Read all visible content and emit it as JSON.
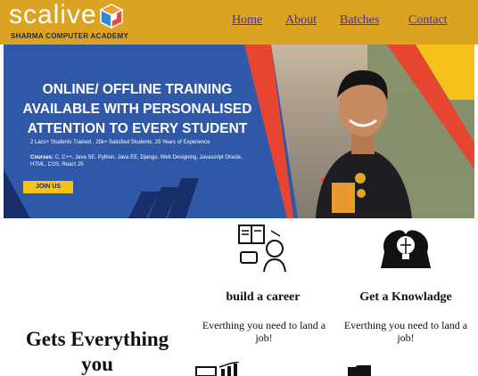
{
  "brand": {
    "name": "scalive",
    "tagline": "SHARMA COMPUTER ACADEMY"
  },
  "nav": {
    "items": [
      "Home",
      "About",
      "Batches",
      "Contact"
    ]
  },
  "hero": {
    "headline": [
      "ONLINE/ OFFLINE TRAINING",
      "AVAILABLE WITH PERSONALISED",
      "ATTENTION TO EVERY STUDENT"
    ],
    "stats": "2 Lacs+ Students Trained , 25k+ Satisfied Students, 25 Years of Experience",
    "courses_label": "Courses:",
    "courses": "C, C++, Java SE, Python, Java EE, Django, Web Designing, Javascript Oracle, HTML, CSS, React JS",
    "cta": "JOIN US"
  },
  "features": [
    {
      "title": "build a career",
      "text": "Everthing you need to land a job!"
    },
    {
      "title": "Get a Knowladge",
      "text": "Everthing you need to land a job!"
    }
  ],
  "section_title": "Gets Everything you"
}
